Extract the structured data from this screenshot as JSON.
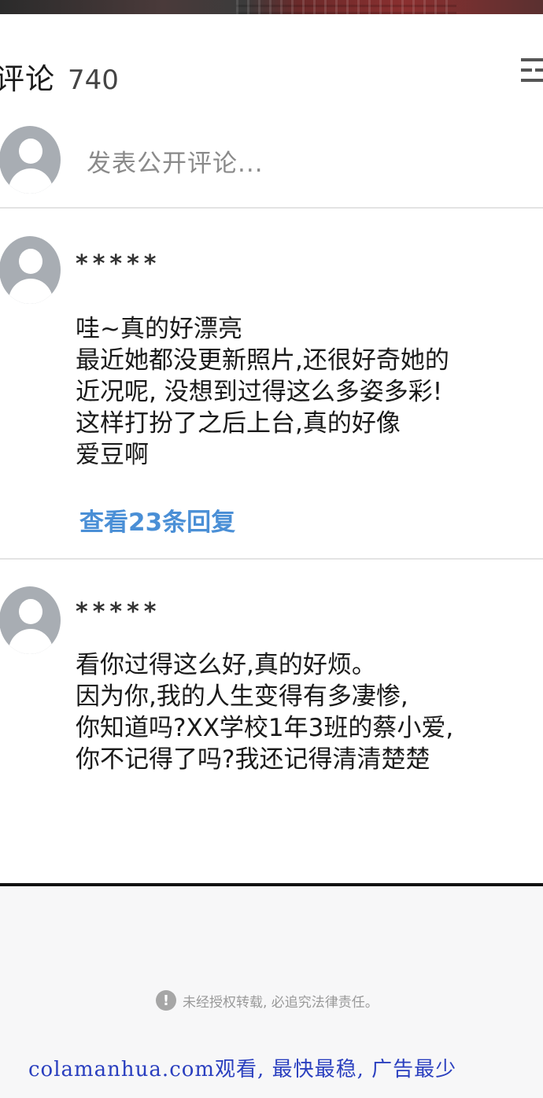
{
  "header": {
    "title": "评论",
    "count": "740"
  },
  "composer": {
    "placeholder": "发表公开评论..."
  },
  "comments": [
    {
      "author": "*****",
      "body": "哇~真的好漂亮\n最近她都没更新照片,还很好奇她的\n近况呢, 没想到过得这么多姿多彩!\n这样打扮了之后上台,真的好像\n爱豆啊",
      "replies_link": "查看23条回复"
    },
    {
      "author": "*****",
      "body": "看你过得这么好,真的好烦。\n因为你,我的人生变得有多凄惨,\n你知道吗?XX学校1年3班的蔡小爱,\n你不记得了吗?我还记得清清楚楚"
    }
  ],
  "notice": {
    "icon": "exclamation-icon",
    "text": "未经授权转载, 必追究法律责任。"
  },
  "watermark": "colamanhua.com观看, 最快最稳, 广告最少",
  "icons": {
    "menu": "menu-icon",
    "avatar": "user-avatar-icon"
  },
  "colors": {
    "link": "#4a8fd6",
    "watermark": "#2a3fbf",
    "avatar": "#a8adb3"
  }
}
